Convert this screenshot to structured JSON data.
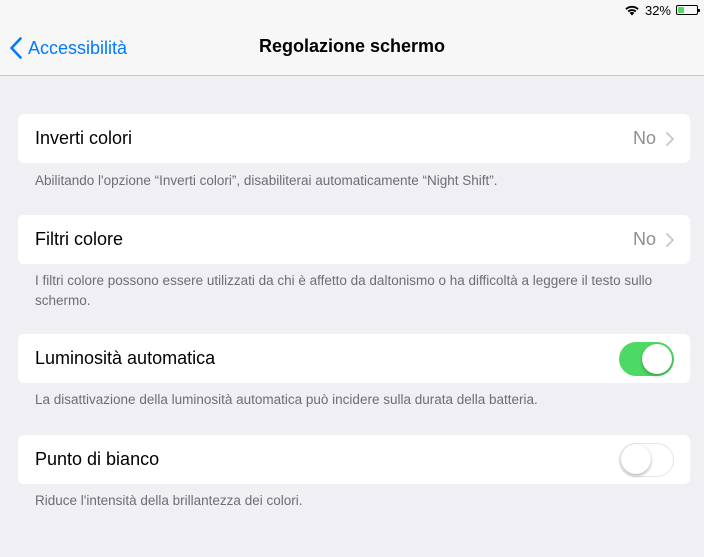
{
  "status_bar": {
    "battery_text": "32%",
    "battery_level": 0.32,
    "battery_color": "#4cd964",
    "wifi_icon": "wifi-icon"
  },
  "nav": {
    "back_label": "Accessibilità",
    "title": "Regolazione schermo",
    "accent_color": "#007aff"
  },
  "settings": {
    "invert_colors": {
      "label": "Inverti colori",
      "value": "No",
      "footnote": "Abilitando l'opzione “Inverti colori”, disabiliterai automaticamente “Night Shift”."
    },
    "color_filters": {
      "label": "Filtri colore",
      "value": "No",
      "footnote": "I filtri colore possono essere utilizzati da chi è affetto da daltonismo o ha difficoltà a leggere il testo sullo schermo."
    },
    "auto_brightness": {
      "label": "Luminosità automatica",
      "enabled": true,
      "footnote": "La disattivazione della luminosità automatica può incidere sulla durata della batteria."
    },
    "white_point": {
      "label": "Punto di bianco",
      "enabled": false,
      "footnote": "Riduce l'intensità della brillantezza dei colori."
    }
  }
}
